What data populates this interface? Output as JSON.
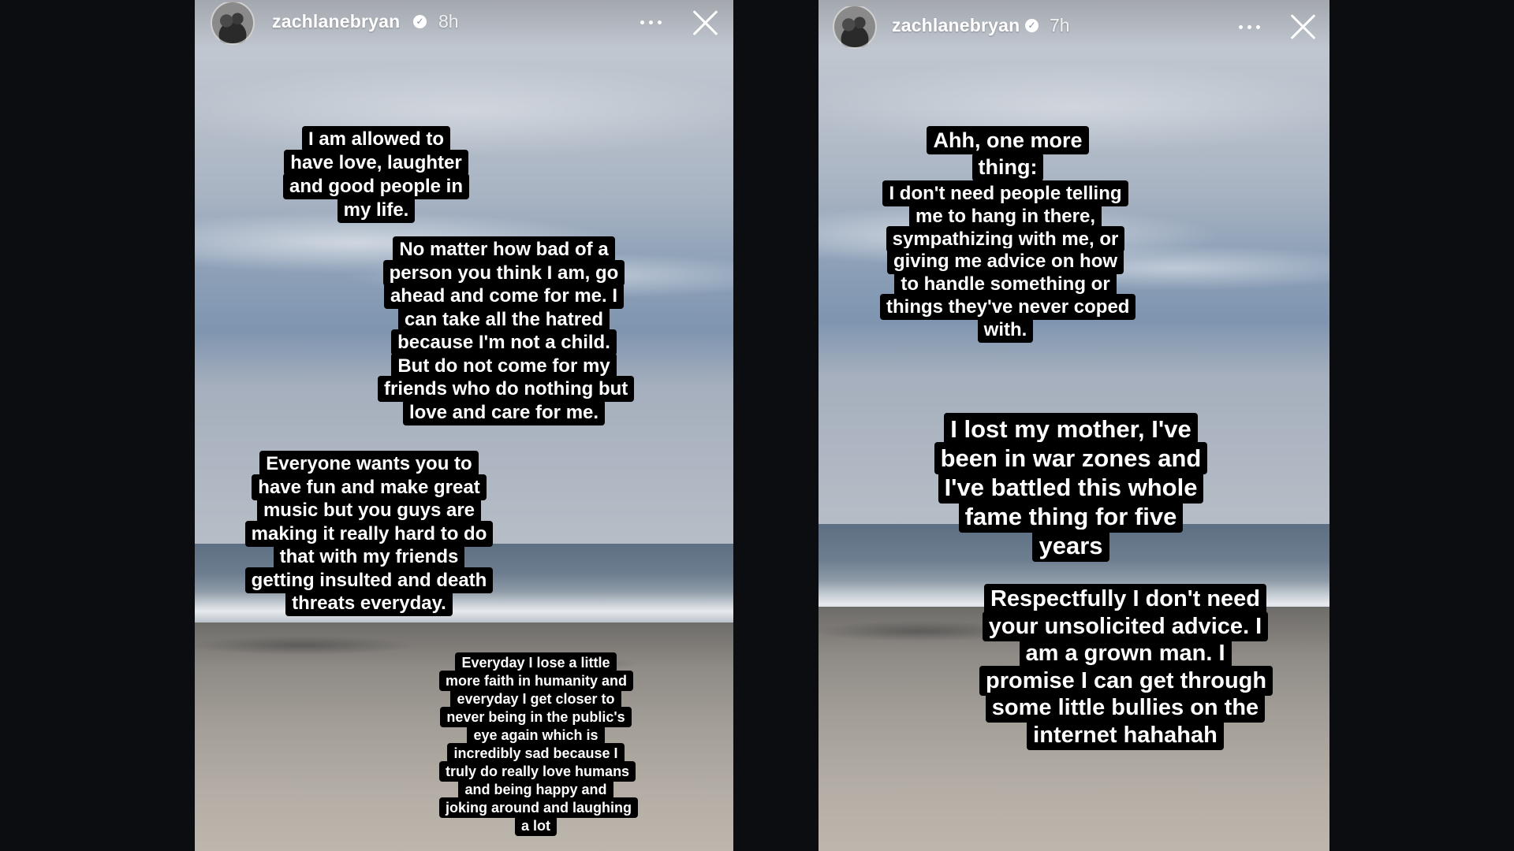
{
  "stories": [
    {
      "username": "zachlanebryan",
      "timestamp": "8h",
      "captions": [
        "I am allowed to have love, laughter and good people in my life.",
        "No matter how bad of a person you think I am, go ahead and come for me. I can take all the hatred because I'm not a child. But do not come for my friends who do nothing but love and care for me.",
        "Everyone wants you to have fun and make great music but you guys are making it really hard to do that with my friends getting insulted and death threats everyday.",
        "Everyday I lose a little more faith in humanity and everyday I get closer to never being in the public's eye again which is incredibly sad because I truly do really love humans and being happy and joking around and laughing a lot"
      ]
    },
    {
      "username": "zachlanebryan",
      "timestamp": "7h",
      "captions": [
        "Ahh, one more thing:",
        "I don't need people telling me to hang in there, sympathizing with me, or giving me advice on how to handle something or things they've never coped with.",
        "I lost my mother, I've been in war zones and I've battled this whole fame thing for five years",
        "Respectfully I don't need your unsolicited advice. I am a grown man. I promise I can get through some little bullies on the internet hahahah"
      ]
    }
  ],
  "icons": {
    "verified": "verified-badge-icon",
    "more": "more-options-icon",
    "close": "close-icon"
  },
  "colors": {
    "page_background": "#0c0d10",
    "caption_background": "#000000",
    "caption_text": "#ffffff"
  }
}
